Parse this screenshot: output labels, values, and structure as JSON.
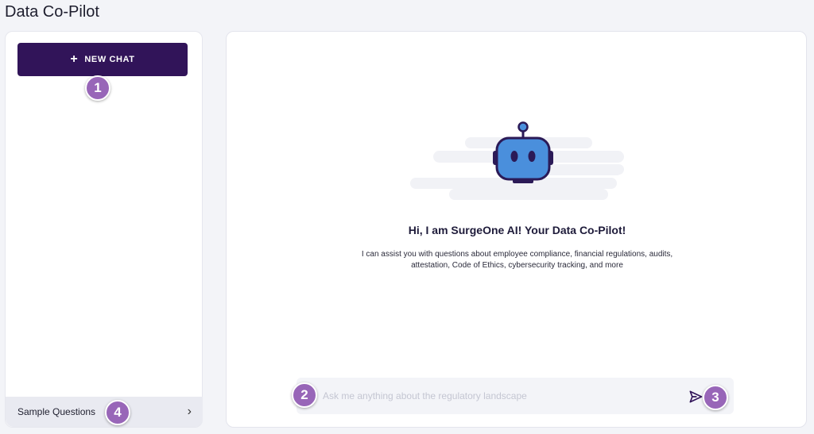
{
  "app": {
    "title": "Data Co-Pilot"
  },
  "sidebar": {
    "new_chat_label": "NEW CHAT",
    "new_chat_icon": "plus-icon",
    "sample_questions_label": "Sample Questions",
    "sample_questions_icon": "chevron-right-icon"
  },
  "main": {
    "greeting": "Hi, I am SurgeOne AI! Your Data Co-Pilot!",
    "description": "I can assist you with questions about employee compliance, financial regulations, audits, attestation, Code of Ethics, cybersecurity tracking, and more",
    "robot_icon": "robot-icon"
  },
  "chat": {
    "placeholder": "Ask me anything about the regulatory landscape",
    "value": "",
    "send_icon": "send-icon"
  },
  "callouts": [
    "1",
    "2",
    "3",
    "4"
  ],
  "colors": {
    "brand": "#311459",
    "badge": "#9866b8",
    "robot_face": "#4a8fdc",
    "robot_dark": "#2b1a57",
    "background": "#f3f4f8"
  }
}
